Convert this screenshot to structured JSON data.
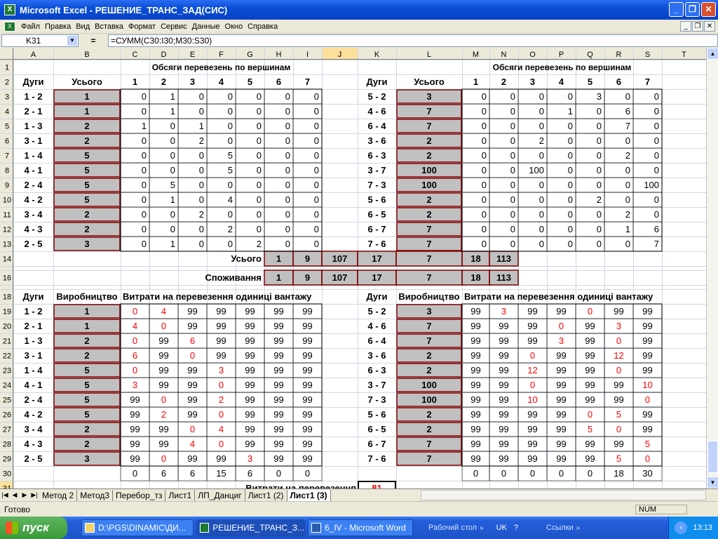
{
  "window": {
    "title": "Microsoft Excel - РЕШЕНИЕ_ТРАНС_ЗАД(СИС)"
  },
  "menu": [
    "Файл",
    "Правка",
    "Вид",
    "Вставка",
    "Формат",
    "Сервис",
    "Данные",
    "Окно",
    "Справка"
  ],
  "formula_bar": {
    "name_box": "K31",
    "fx": "=",
    "formula": "=СУММ(C30:I30;M30:S30)"
  },
  "columns": [
    "A",
    "B",
    "C",
    "D",
    "E",
    "F",
    "G",
    "H",
    "I",
    "J",
    "K",
    "L",
    "M",
    "N",
    "O",
    "P",
    "Q",
    "R",
    "S",
    "T"
  ],
  "rows": [
    "1",
    "2",
    "3",
    "4",
    "5",
    "6",
    "7",
    "8",
    "9",
    "10",
    "11",
    "12",
    "13",
    "14",
    "15",
    "16",
    "17",
    "18",
    "19",
    "20",
    "21",
    "22",
    "23",
    "24",
    "25",
    "26",
    "27",
    "28",
    "29",
    "30",
    "31"
  ],
  "headers": {
    "volumes": "Обсяги перевезень по вершинам",
    "arcs": "Дуги",
    "total": "Усього",
    "nums": [
      "1",
      "2",
      "3",
      "4",
      "5",
      "6",
      "7"
    ],
    "consumption": "Споживання",
    "production": "Виробництво",
    "costs": "Витрати на перевезення одиниці вантажу",
    "transport_cost": "Витрати на перевезення",
    "transport_cost_value": "81"
  },
  "left": {
    "arcs": [
      "1 - 2",
      "2 - 1",
      "1 - 3",
      "3 - 1",
      "1 - 4",
      "4 - 1",
      "2 - 4",
      "4 - 2",
      "3 - 4",
      "4 - 3",
      "2 - 5"
    ],
    "totals": [
      "1",
      "1",
      "2",
      "2",
      "5",
      "5",
      "5",
      "5",
      "2",
      "2",
      "3"
    ],
    "flows": [
      [
        "0",
        "1",
        "0",
        "0",
        "0",
        "0",
        "0"
      ],
      [
        "0",
        "1",
        "0",
        "0",
        "0",
        "0",
        "0"
      ],
      [
        "1",
        "0",
        "1",
        "0",
        "0",
        "0",
        "0"
      ],
      [
        "0",
        "0",
        "2",
        "0",
        "0",
        "0",
        "0"
      ],
      [
        "0",
        "0",
        "0",
        "5",
        "0",
        "0",
        "0"
      ],
      [
        "0",
        "0",
        "0",
        "5",
        "0",
        "0",
        "0"
      ],
      [
        "0",
        "5",
        "0",
        "0",
        "0",
        "0",
        "0"
      ],
      [
        "0",
        "1",
        "0",
        "4",
        "0",
        "0",
        "0"
      ],
      [
        "0",
        "0",
        "2",
        "0",
        "0",
        "0",
        "0"
      ],
      [
        "0",
        "0",
        "0",
        "2",
        "0",
        "0",
        "0"
      ],
      [
        "0",
        "1",
        "0",
        "0",
        "2",
        "0",
        "0"
      ]
    ],
    "costs": [
      [
        "0",
        "4",
        "99",
        "99",
        "99",
        "99",
        "99"
      ],
      [
        "4",
        "0",
        "99",
        "99",
        "99",
        "99",
        "99"
      ],
      [
        "0",
        "99",
        "6",
        "99",
        "99",
        "99",
        "99"
      ],
      [
        "6",
        "99",
        "0",
        "99",
        "99",
        "99",
        "99"
      ],
      [
        "0",
        "99",
        "99",
        "3",
        "99",
        "99",
        "99"
      ],
      [
        "3",
        "99",
        "99",
        "0",
        "99",
        "99",
        "99"
      ],
      [
        "99",
        "0",
        "99",
        "2",
        "99",
        "99",
        "99"
      ],
      [
        "99",
        "2",
        "99",
        "0",
        "99",
        "99",
        "99"
      ],
      [
        "99",
        "99",
        "0",
        "4",
        "99",
        "99",
        "99"
      ],
      [
        "99",
        "99",
        "4",
        "0",
        "99",
        "99",
        "99"
      ],
      [
        "99",
        "0",
        "99",
        "99",
        "3",
        "99",
        "99"
      ]
    ],
    "row30": [
      "0",
      "6",
      "6",
      "15",
      "6",
      "0",
      "0"
    ]
  },
  "right": {
    "arcs": [
      "5 - 2",
      "4 - 6",
      "6 - 4",
      "3 - 6",
      "6 - 3",
      "3 - 7",
      "7 - 3",
      "5 - 6",
      "6 - 5",
      "6 - 7",
      "7 - 6"
    ],
    "totals": [
      "3",
      "7",
      "7",
      "2",
      "2",
      "100",
      "100",
      "2",
      "2",
      "7",
      "7"
    ],
    "flows": [
      [
        "0",
        "0",
        "0",
        "0",
        "3",
        "0",
        "0"
      ],
      [
        "0",
        "0",
        "0",
        "1",
        "0",
        "6",
        "0"
      ],
      [
        "0",
        "0",
        "0",
        "0",
        "0",
        "7",
        "0"
      ],
      [
        "0",
        "0",
        "2",
        "0",
        "0",
        "0",
        "0"
      ],
      [
        "0",
        "0",
        "0",
        "0",
        "0",
        "2",
        "0"
      ],
      [
        "0",
        "0",
        "100",
        "0",
        "0",
        "0",
        "0"
      ],
      [
        "0",
        "0",
        "0",
        "0",
        "0",
        "0",
        "100"
      ],
      [
        "0",
        "0",
        "0",
        "0",
        "2",
        "0",
        "0"
      ],
      [
        "0",
        "0",
        "0",
        "0",
        "0",
        "2",
        "0"
      ],
      [
        "0",
        "0",
        "0",
        "0",
        "0",
        "1",
        "6"
      ],
      [
        "0",
        "0",
        "0",
        "0",
        "0",
        "0",
        "7"
      ]
    ],
    "costs": [
      [
        "99",
        "3",
        "99",
        "99",
        "0",
        "99",
        "99"
      ],
      [
        "99",
        "99",
        "99",
        "0",
        "99",
        "3",
        "99"
      ],
      [
        "99",
        "99",
        "99",
        "3",
        "99",
        "0",
        "99"
      ],
      [
        "99",
        "99",
        "0",
        "99",
        "99",
        "12",
        "99"
      ],
      [
        "99",
        "99",
        "12",
        "99",
        "99",
        "0",
        "99"
      ],
      [
        "99",
        "99",
        "0",
        "99",
        "99",
        "99",
        "10"
      ],
      [
        "99",
        "99",
        "10",
        "99",
        "99",
        "99",
        "0"
      ],
      [
        "99",
        "99",
        "99",
        "99",
        "0",
        "5",
        "99"
      ],
      [
        "99",
        "99",
        "99",
        "99",
        "5",
        "0",
        "99"
      ],
      [
        "99",
        "99",
        "99",
        "99",
        "99",
        "99",
        "5"
      ],
      [
        "99",
        "99",
        "99",
        "99",
        "99",
        "5",
        "0"
      ]
    ],
    "row30": [
      "0",
      "0",
      "0",
      "0",
      "0",
      "18",
      "30"
    ]
  },
  "summary": {
    "row14": [
      "1",
      "9",
      "107",
      "17",
      "7",
      "18",
      "113"
    ],
    "row16": [
      "1",
      "9",
      "107",
      "17",
      "7",
      "18",
      "113"
    ]
  },
  "sheet_tabs": [
    "Метод 2",
    "Метод3",
    "Перебор_тз",
    "Лист1",
    "ЛП_Данциг",
    "Лист1 (2)",
    "Лист1 (3)"
  ],
  "status": {
    "ready": "Готово",
    "num": "NUM"
  },
  "taskbar": {
    "start": "пуск",
    "items": [
      "D:\\PGS\\DINAMIC\\ДИ...",
      "РЕШЕНИЕ_ТРАНС_З...",
      "6_IV - Microsoft Word"
    ],
    "desktop": "Рабочий стол",
    "lang": "UK",
    "links": "Ссылки",
    "time": "13:13"
  },
  "colors": {
    "red": "#ff0000",
    "gray": "#c0c0c0",
    "border": "#800000",
    "header": "#ece9d8"
  }
}
